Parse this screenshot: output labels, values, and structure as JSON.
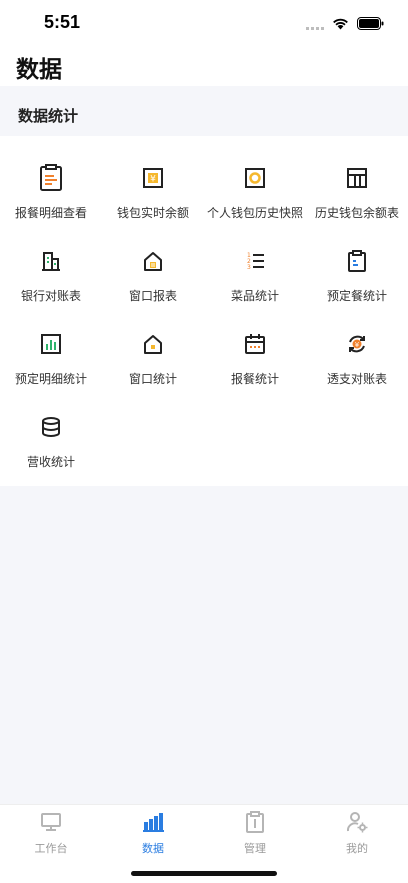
{
  "status": {
    "time": "5:51"
  },
  "header": {
    "title": "数据"
  },
  "section": {
    "title": "数据统计"
  },
  "grid": [
    {
      "label": "报餐明细查看",
      "icon": "clipboard-report-icon"
    },
    {
      "label": "钱包实时余额",
      "icon": "wallet-yen-icon"
    },
    {
      "label": "个人钱包历史快照",
      "icon": "wallet-snapshot-icon"
    },
    {
      "label": "历史钱包余额表",
      "icon": "table-icon"
    },
    {
      "label": "银行对账表",
      "icon": "bank-building-icon"
    },
    {
      "label": "窗口报表",
      "icon": "window-house-report-icon"
    },
    {
      "label": "菜品统计",
      "icon": "numbered-list-icon"
    },
    {
      "label": "预定餐统计",
      "icon": "clipboard-booking-icon"
    },
    {
      "label": "预定明细统计",
      "icon": "bar-chart-box-icon"
    },
    {
      "label": "窗口统计",
      "icon": "window-house-icon"
    },
    {
      "label": "报餐统计",
      "icon": "calendar-icon"
    },
    {
      "label": "透支对账表",
      "icon": "yen-refresh-icon"
    },
    {
      "label": "营收统计",
      "icon": "database-icon"
    }
  ],
  "tabs": [
    {
      "label": "工作台",
      "icon": "monitor-icon",
      "active": false
    },
    {
      "label": "数据",
      "icon": "bar-chart-icon",
      "active": true
    },
    {
      "label": "管理",
      "icon": "clipboard-manage-icon",
      "active": false
    },
    {
      "label": "我的",
      "icon": "user-settings-icon",
      "active": false
    }
  ],
  "colors": {
    "accent": "#2a7de1",
    "orange": "#f0812d",
    "yellow": "#f5b82e",
    "green": "#2fb36b",
    "inactive": "#9a9a9a"
  }
}
